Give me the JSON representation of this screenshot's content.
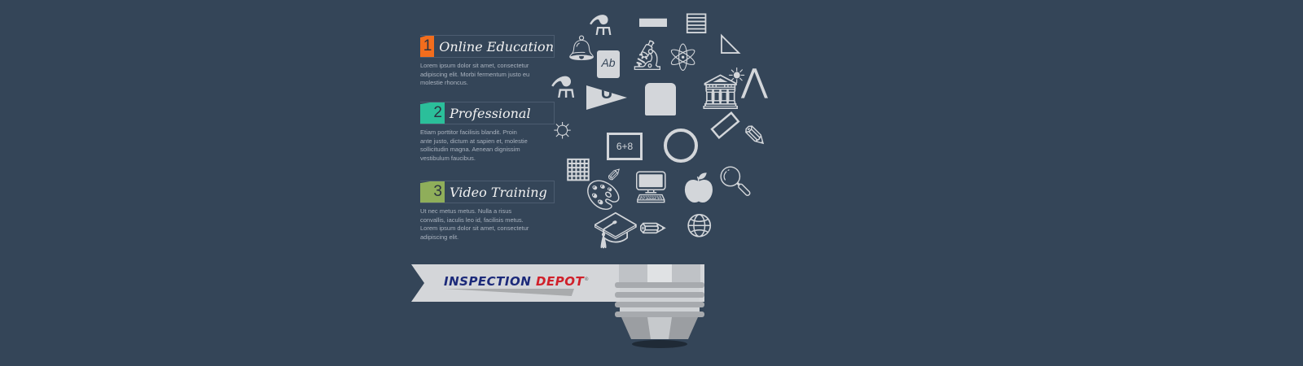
{
  "items": [
    {
      "number": "1",
      "title": "Online Education",
      "color": "#f26d1d",
      "text": "Lorem ipsum dolor sit amet, consectetur adipiscing elit. Morbi fermentum justo eu molestie rhoncus."
    },
    {
      "number": "2",
      "title": "Professional",
      "color": "#2bbf9a",
      "text": "Etiam porttitor facilisis blandit. Proin ante justo, dictum at sapien et, molestie sollicitudin magna. Aenean dignissim vestibulum faucibus."
    },
    {
      "number": "3",
      "title": "Video Training",
      "color": "#8fae5a",
      "text": "Ut nec metus metus. Nulla a risus convallis, iaculis leo id, facilisis metus. Lorem ipsum dolor sit amet, consectetur adipiscing elit."
    }
  ],
  "logo": {
    "part1": "INSPECTION",
    "part2": "DEPOT",
    "mark": "®"
  },
  "chalkboard": "6+8",
  "book_label": "Ab",
  "pennant_letter": "U"
}
